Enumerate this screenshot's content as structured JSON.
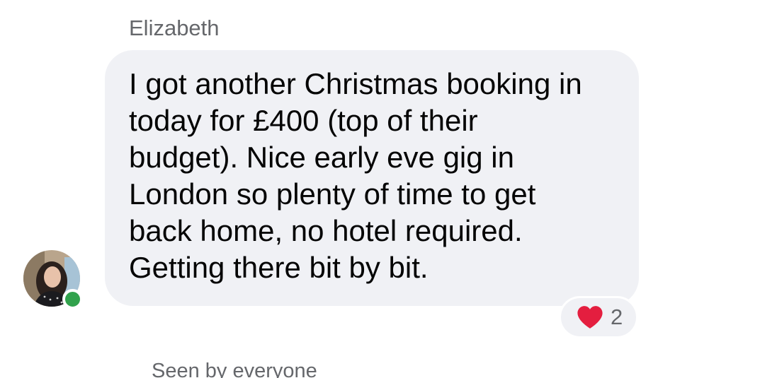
{
  "message": {
    "sender_name": "Elizabeth",
    "text": "I got another Christmas booking in\ntoday for £400 (top of their\nbudget). Nice early eve gig in\nLondon so plenty of time to get\nback home, no hotel required.\nGetting there bit by bit.",
    "reaction": {
      "icon": "heart-icon",
      "color": "#e41e3f",
      "count": "2"
    },
    "avatar": {
      "online_color": "#31a24c"
    }
  },
  "footer": {
    "seen_label": "Seen by everyone"
  }
}
